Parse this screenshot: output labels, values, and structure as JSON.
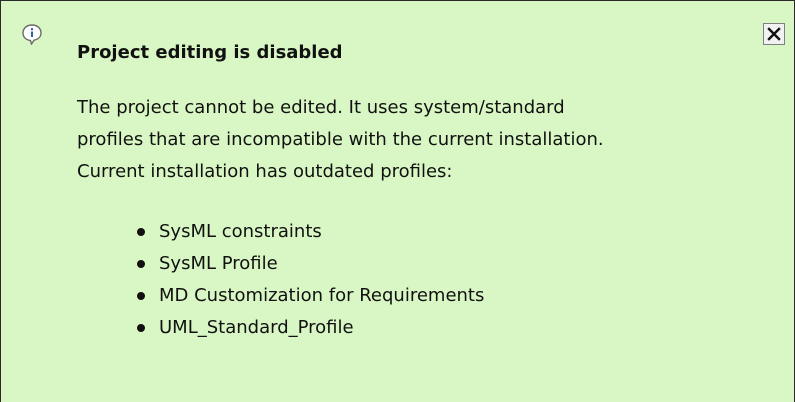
{
  "notification": {
    "icon": "info-speech-bubble-icon",
    "close_icon": "close-icon",
    "title": "Project editing is disabled",
    "message_lines": [
      "The project cannot be edited. It uses system/standard",
      "profiles that are incompatible with the current installation.",
      "Current installation has outdated profiles:"
    ],
    "profiles": [
      "SysML constraints",
      "SysML Profile",
      "MD Customization for Requirements",
      "UML_Standard_Profile"
    ],
    "colors": {
      "background": "#d9f7c4",
      "border": "#2b2b2b",
      "text": "#111111"
    }
  }
}
